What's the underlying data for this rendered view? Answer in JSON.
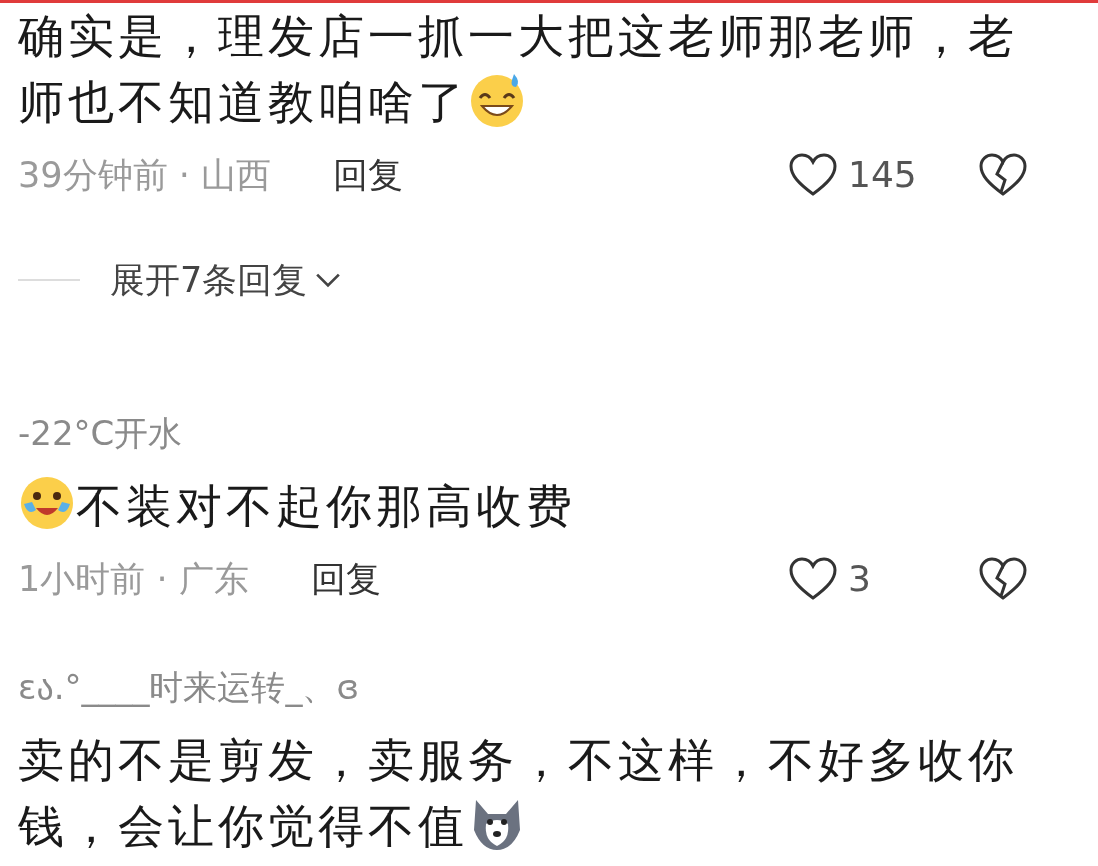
{
  "comments": [
    {
      "parts": [
        {
          "kind": "text",
          "text": "确实是，理发店一抓一大把这老师那老师，老师也不知道教咱啥了"
        },
        {
          "kind": "sweat-smile-emoji"
        }
      ],
      "meta": "39分钟前 · 山西",
      "reply": "回复",
      "likes": "145",
      "more_replies": "展开7条回复"
    },
    {
      "username": "-22°C开水",
      "parts": [
        {
          "kind": "laugh-cry-emoji"
        },
        {
          "kind": "text",
          "text": "不装对不起你那高收费"
        }
      ],
      "meta": "1小时前 · 广东",
      "reply": "回复",
      "likes": "3"
    },
    {
      "username": "ɛა.°____时来运转_、ɞ",
      "parts": [
        {
          "kind": "text",
          "text": "卖的不是剪发，卖服务，不这样，不好多收你钱，会让你觉得不值"
        },
        {
          "kind": "dog-emoji"
        }
      ]
    }
  ]
}
